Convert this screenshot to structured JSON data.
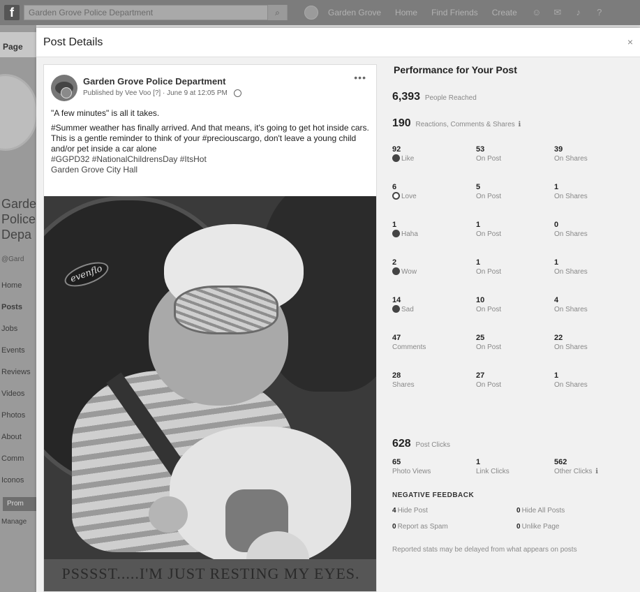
{
  "topbar": {
    "logo": "f",
    "search_value": "Garden Grove Police Department",
    "search_icon": "search-icon",
    "profile_name": "Garden Grove",
    "links": [
      "Home",
      "Find Friends",
      "Create"
    ]
  },
  "left_page": {
    "tab_label": "Page",
    "name_lines": [
      "Garde",
      "Police",
      "Depa"
    ],
    "sub": "@Gard",
    "nav": [
      "Home",
      "Posts",
      "Jobs",
      "Events",
      "Reviews",
      "Videos",
      "Photos",
      "About",
      "Comm",
      "Iconos"
    ],
    "button": "Prom",
    "manage": "Manage"
  },
  "modal": {
    "title": "Post Details",
    "close_label": "×"
  },
  "post": {
    "author": "Garden Grove Police Department",
    "published_by": "Published by Vee Voo",
    "published_date": "June 9 at 12:05 PM",
    "more_label": "•••",
    "text_line1": "\"A few minutes\" is all it takes.",
    "text_para2": "#Summer weather has finally arrived. And that means, it's going to get hot inside cars. This is a gentle reminder to think of your #preciouscargo, don't leave a young child and/or pet inside a car alone",
    "hashtags": "#GGPD32 #NationalChildrensDay #ItsHot",
    "location": "Garden Grove City Hall",
    "photo_brand": "evenflo",
    "photo_caption": "PSSSST.....I'M JUST RESTING MY EYES."
  },
  "performance": {
    "title": "Performance for Your Post",
    "reached_value": "6,393",
    "reached_label": "People Reached",
    "reactions_value": "190",
    "reactions_label": "Reactions, Comments & Shares",
    "rows": [
      {
        "icon": "like-icon",
        "total": "92",
        "label": "Like",
        "on_post": "53",
        "on_post_label": "On Post",
        "on_shares": "39",
        "on_shares_label": "On Shares"
      },
      {
        "icon": "love-icon",
        "total": "6",
        "label": "Love",
        "on_post": "5",
        "on_post_label": "On Post",
        "on_shares": "1",
        "on_shares_label": "On Shares"
      },
      {
        "icon": "haha-icon",
        "total": "1",
        "label": "Haha",
        "on_post": "1",
        "on_post_label": "On Post",
        "on_shares": "0",
        "on_shares_label": "On Shares"
      },
      {
        "icon": "wow-icon",
        "total": "2",
        "label": "Wow",
        "on_post": "1",
        "on_post_label": "On Post",
        "on_shares": "1",
        "on_shares_label": "On Shares"
      },
      {
        "icon": "sad-icon",
        "total": "14",
        "label": "Sad",
        "on_post": "10",
        "on_post_label": "On Post",
        "on_shares": "4",
        "on_shares_label": "On Shares"
      },
      {
        "icon": "",
        "total": "47",
        "label": "Comments",
        "on_post": "25",
        "on_post_label": "On Post",
        "on_shares": "22",
        "on_shares_label": "On Shares"
      },
      {
        "icon": "",
        "total": "28",
        "label": "Shares",
        "on_post": "27",
        "on_post_label": "On Post",
        "on_shares": "1",
        "on_shares_label": "On Shares"
      }
    ],
    "clicks_value": "628",
    "clicks_label": "Post Clicks",
    "photo_views_value": "65",
    "photo_views_label": "Photo Views",
    "link_clicks_value": "1",
    "link_clicks_label": "Link Clicks",
    "other_clicks_value": "562",
    "other_clicks_label": "Other Clicks",
    "negative_title": "NEGATIVE FEEDBACK",
    "hide_post_value": "4",
    "hide_post_label": "Hide Post",
    "hide_all_value": "0",
    "hide_all_label": "Hide All Posts",
    "report_spam_value": "0",
    "report_spam_label": "Report as Spam",
    "unlike_value": "0",
    "unlike_label": "Unlike Page",
    "note": "Reported stats may be delayed from what appears on posts"
  }
}
